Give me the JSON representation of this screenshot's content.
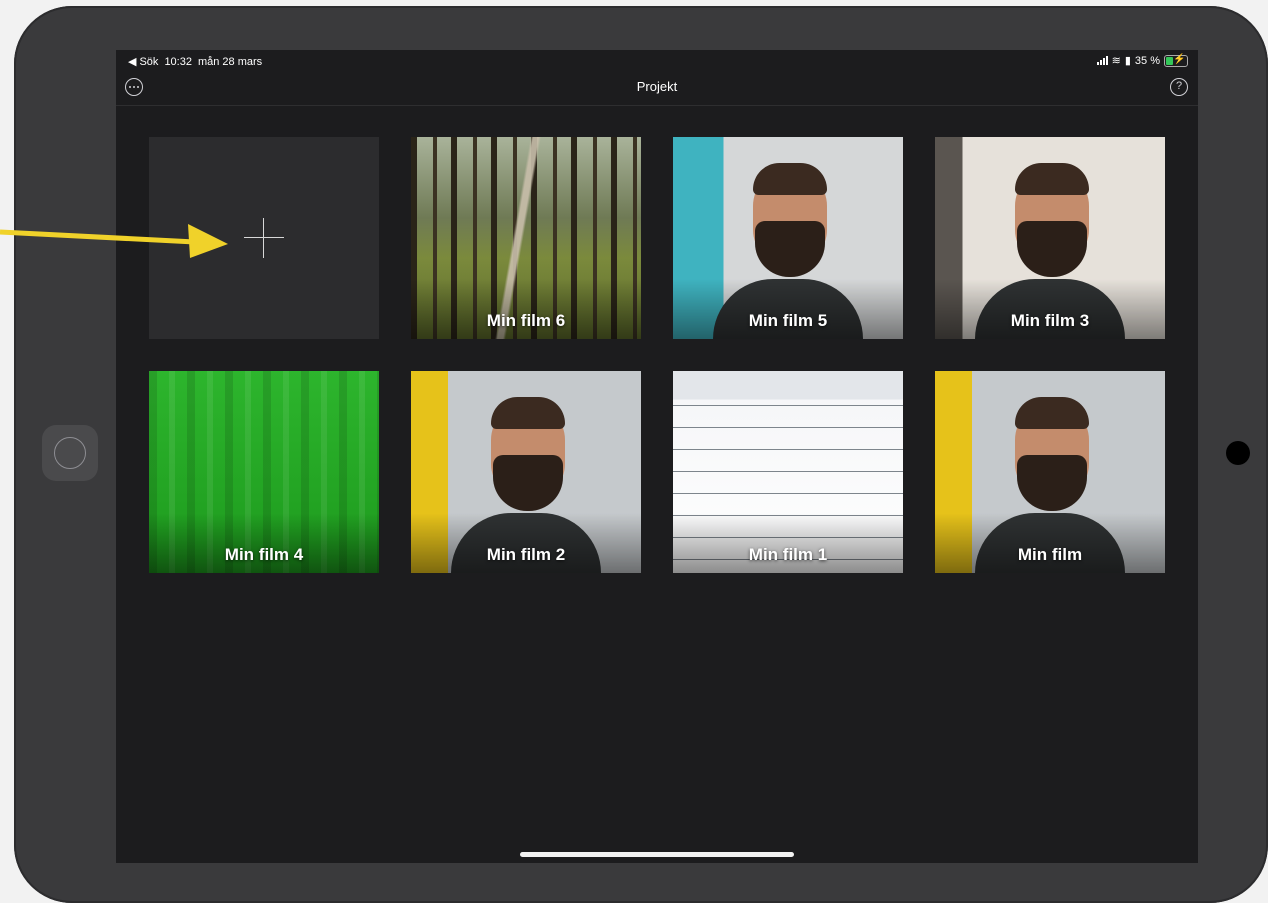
{
  "statusbar": {
    "back_label": "Sök",
    "time": "10:32",
    "date": "mån 28 mars",
    "battery": "35 %"
  },
  "navbar": {
    "title": "Projekt",
    "help_label": "?"
  },
  "projects": [
    {
      "title": "Min film 6"
    },
    {
      "title": "Min film 5"
    },
    {
      "title": "Min film 3"
    },
    {
      "title": "Min film 4"
    },
    {
      "title": "Min film 2"
    },
    {
      "title": "Min film 1"
    },
    {
      "title": "Min film"
    }
  ],
  "colors": {
    "background": "#1c1c1e",
    "tile": "#2c2c2e",
    "arrow": "#f0d22a"
  },
  "icons": [
    "more-icon",
    "help-icon",
    "plus-icon",
    "signal-icon",
    "wifi-icon",
    "battery-icon"
  ]
}
